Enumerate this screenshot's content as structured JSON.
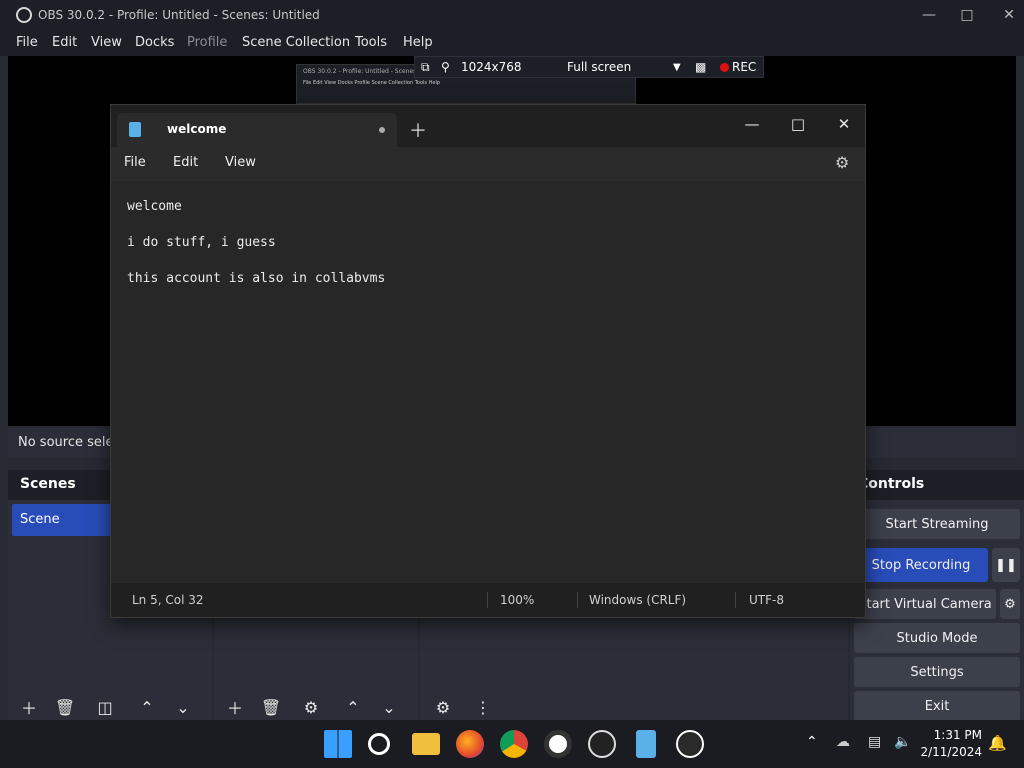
{
  "obs": {
    "title": "OBS 30.0.2 - Profile: Untitled - Scenes: Untitled",
    "menu": [
      "File",
      "Edit",
      "View",
      "Docks",
      "Profile",
      "Scene Collection",
      "Tools",
      "Help"
    ],
    "projector": {
      "resolution": "1024x768",
      "mode": "Full screen",
      "rec_label": "REC"
    },
    "nested_title": "OBS 30.0.2 - Profile: Untitled - Scenes: Untitled",
    "nested_menu": "File  Edit  View  Docks  Profile  Scene Collection  Tools  Help",
    "no_source": "No source selected",
    "scenes": {
      "header": "Scenes",
      "items": [
        "Scene"
      ]
    },
    "controls": {
      "header": "Controls",
      "start_streaming": "Start Streaming",
      "stop_recording": "Stop Recording",
      "start_virtual_camera": "Start Virtual Camera",
      "studio_mode": "Studio Mode",
      "settings": "Settings",
      "exit": "Exit"
    }
  },
  "notepad": {
    "tab_title": "welcome",
    "menu": [
      "File",
      "Edit",
      "View"
    ],
    "lines": [
      "welcome",
      "i do stuff, i guess",
      "this account is also in collabvms"
    ],
    "status": {
      "position": "Ln 5, Col 32",
      "zoom": "100%",
      "line_ending": "Windows (CRLF)",
      "encoding": "UTF-8"
    }
  },
  "taskbar": {
    "time": "1:31 PM",
    "date": "2/11/2024",
    "icons": [
      "start-icon",
      "search-icon",
      "file-explorer-icon",
      "firefox-icon",
      "chrome-icon",
      "record-icon",
      "obs-icon",
      "notepad-icon",
      "media-player-icon"
    ]
  },
  "colors": {
    "accent": "#284cb8",
    "rec": "#e01010",
    "notepad_bg": "#272727"
  }
}
